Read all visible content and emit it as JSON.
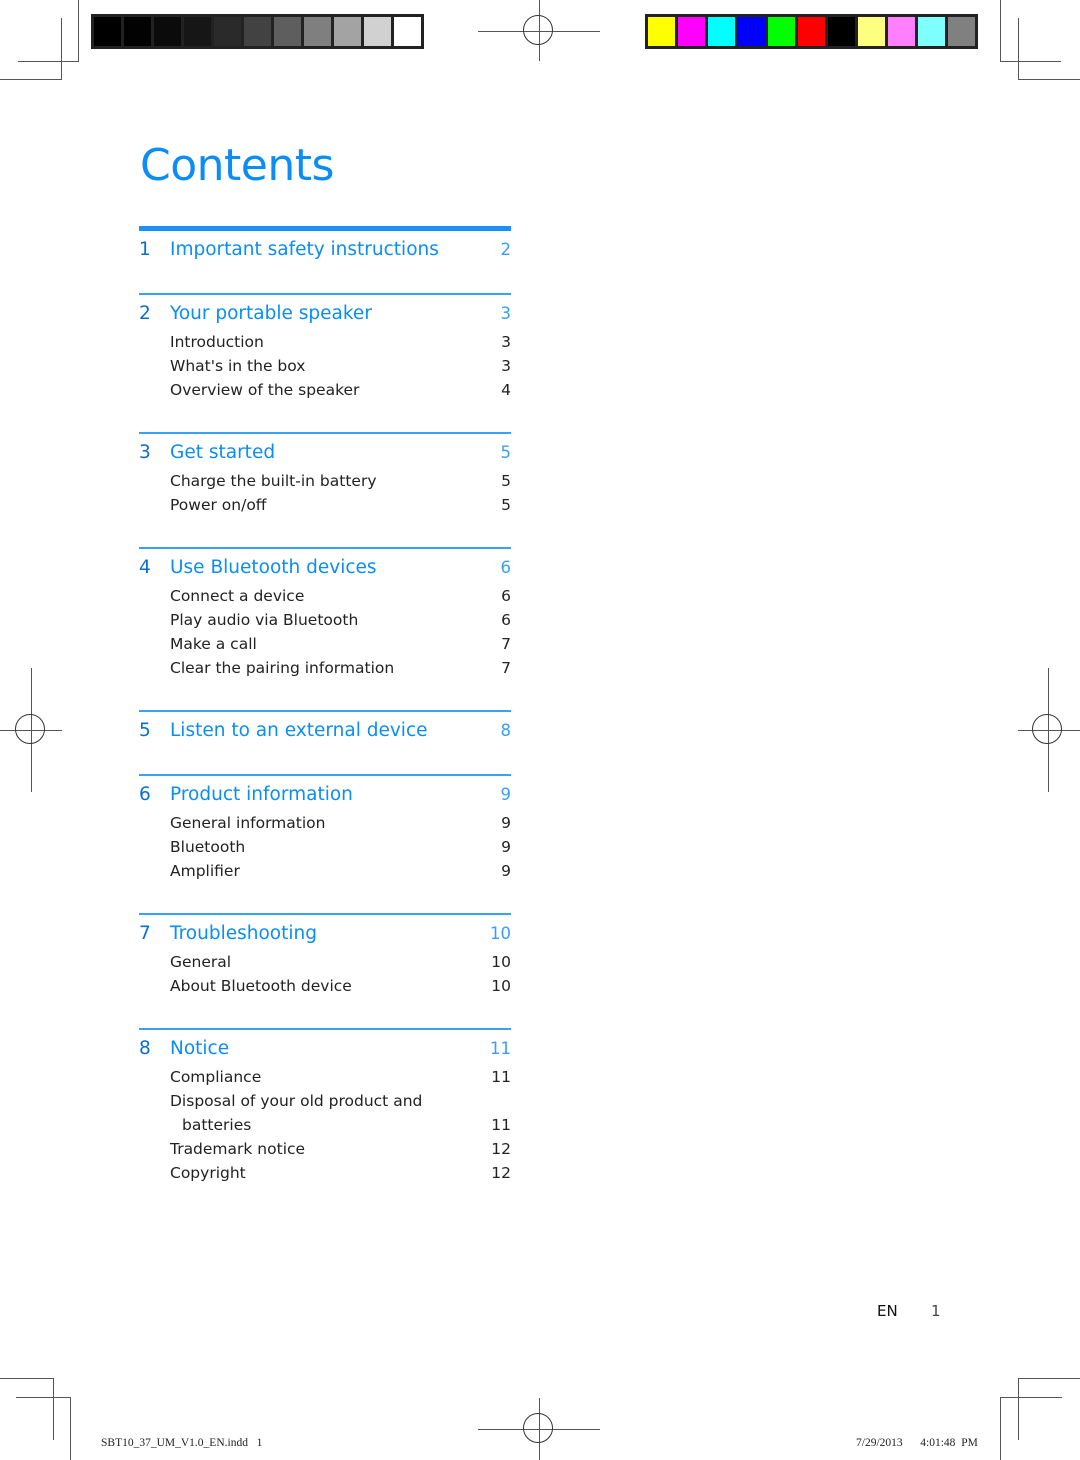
{
  "print_marks": {
    "grayscale_bar": [
      "#000000",
      "#020202",
      "#0b0b0b",
      "#161616",
      "#2a2a2a",
      "#424242",
      "#5e5e5e",
      "#7f7f7f",
      "#a3a3a3",
      "#d1d1d1",
      "#ffffff"
    ],
    "color_bar": [
      "#ffff00",
      "#ff00ff",
      "#00ffff",
      "#0000ff",
      "#00ff00",
      "#ff0000",
      "#000000",
      "#ffff80",
      "#ff80ff",
      "#80ffff",
      "#808080"
    ]
  },
  "colors": {
    "accent_blue": "#0a8df5"
  },
  "page_title": "Contents",
  "toc": [
    {
      "num": "1",
      "title": "Important safety instructions",
      "page": "2",
      "entries": []
    },
    {
      "num": "2",
      "title": "Your portable speaker",
      "page": "3",
      "entries": [
        {
          "label": "Introduction",
          "page": "3"
        },
        {
          "label": "What's in the box",
          "page": "3"
        },
        {
          "label": "Overview of the speaker",
          "page": "4"
        }
      ]
    },
    {
      "num": "3",
      "title": "Get started",
      "page": "5",
      "entries": [
        {
          "label": "Charge the built-in battery",
          "page": "5"
        },
        {
          "label": "Power on/off",
          "page": "5"
        }
      ]
    },
    {
      "num": "4",
      "title": "Use Bluetooth devices",
      "page": "6",
      "entries": [
        {
          "label": "Connect a device",
          "page": "6"
        },
        {
          "label": "Play audio via Bluetooth",
          "page": "6"
        },
        {
          "label": "Make a call",
          "page": "7"
        },
        {
          "label": "Clear the pairing information",
          "page": "7"
        }
      ]
    },
    {
      "num": "5",
      "title": "Listen to an external device",
      "page": "8",
      "entries": []
    },
    {
      "num": "6",
      "title": "Product information",
      "page": "9",
      "entries": [
        {
          "label": "General information",
          "page": "9"
        },
        {
          "label": "Bluetooth",
          "page": "9"
        },
        {
          "label": "Amplifier",
          "page": "9"
        }
      ]
    },
    {
      "num": "7",
      "title": "Troubleshooting",
      "page": "10",
      "entries": [
        {
          "label": "General",
          "page": "10"
        },
        {
          "label": "About Bluetooth device",
          "page": "10"
        }
      ]
    },
    {
      "num": "8",
      "title": "Notice",
      "page": "11",
      "entries": [
        {
          "label": "Compliance",
          "page": "11"
        },
        {
          "label": "Disposal of your old product and",
          "page": ""
        },
        {
          "label": "batteries",
          "page": "11",
          "indent": true
        },
        {
          "label": "Trademark notice",
          "page": "12"
        },
        {
          "label": "Copyright",
          "page": "12"
        }
      ]
    }
  ],
  "footer": {
    "language": "EN",
    "page_number": "1",
    "slug_file": "SBT10_37_UM_V1.0_EN.indd   1",
    "slug_timestamp": "7/29/2013   4:01:48 PM"
  }
}
